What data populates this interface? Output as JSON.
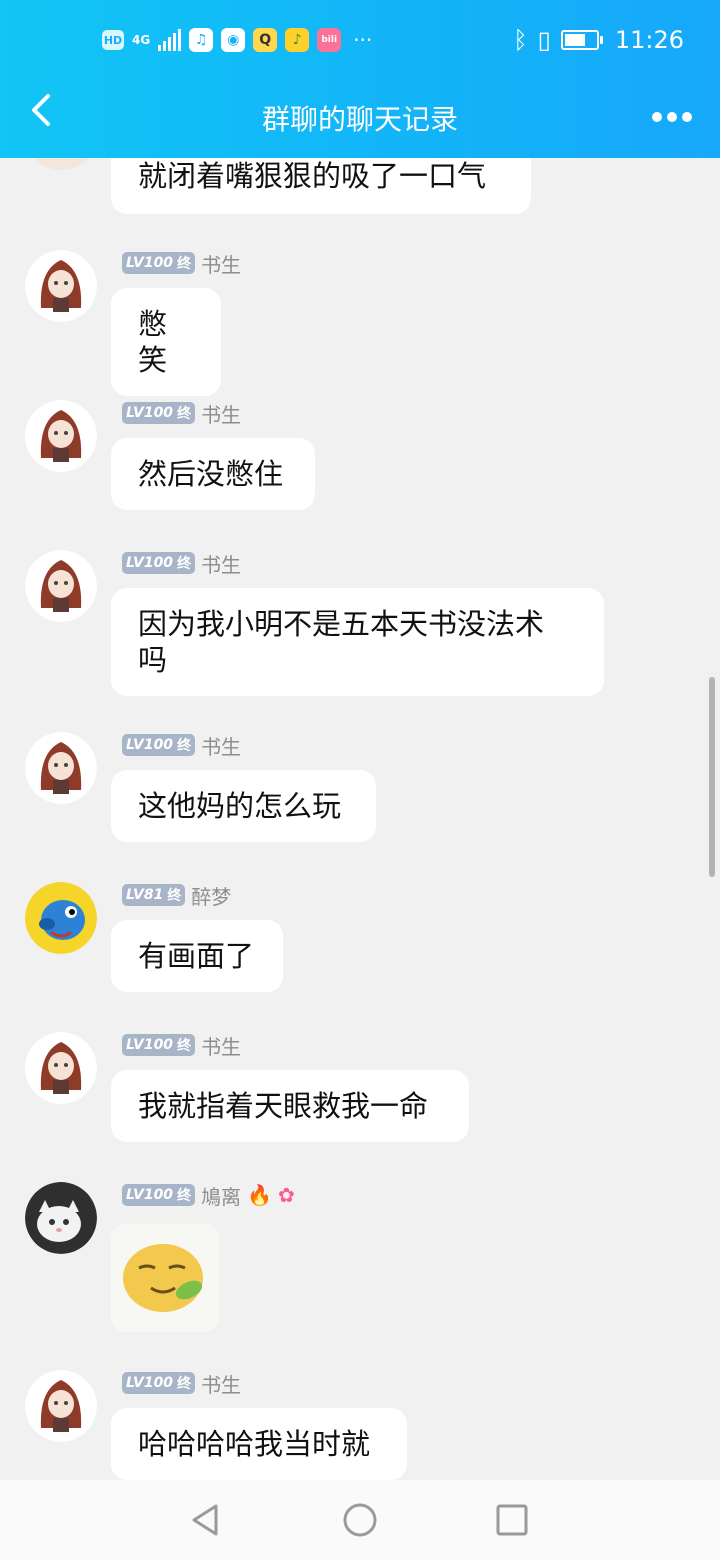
{
  "status_bar": {
    "hd": "HD",
    "network": "4G",
    "more": "···",
    "time": "11:26",
    "colors": {
      "accent_start": "#12c5f6",
      "accent_end": "#17a8fa"
    }
  },
  "header": {
    "title": "群聊的聊天记录"
  },
  "first_message_tail": "就闭着嘴狠狠的吸了一口气",
  "messages": [
    {
      "level": "LV100",
      "tag": "终",
      "name": "书生",
      "text": "憋笑"
    },
    {
      "level": "LV100",
      "tag": "终",
      "name": "书生",
      "text": "然后没憋住"
    },
    {
      "level": "LV100",
      "tag": "终",
      "name": "书生",
      "text": "因为我小明不是五本天书没法术",
      "text2": "吗"
    },
    {
      "level": "LV100",
      "tag": "终",
      "name": "书生",
      "text": "这他妈的怎么玩"
    },
    {
      "level": "LV81",
      "tag": "终",
      "name": "醉梦",
      "text": "有画面了"
    },
    {
      "level": "LV100",
      "tag": "终",
      "name": "书生",
      "text": "我就指着天眼救我一命"
    },
    {
      "level": "LV100",
      "tag": "终",
      "name": "鳩离",
      "text": "",
      "sticker": "smiley-leaf-sticker"
    },
    {
      "level": "LV100",
      "tag": "终",
      "name": "书生",
      "text": "哈哈哈哈我当时就"
    }
  ]
}
